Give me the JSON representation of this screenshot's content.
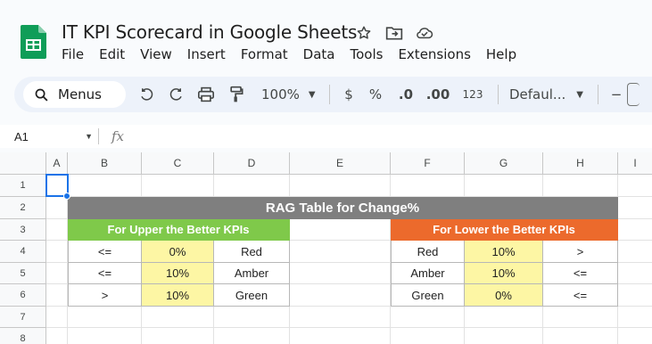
{
  "app": {
    "title": "IT KPI Scorecard in Google Sheets",
    "menu": [
      "File",
      "Edit",
      "View",
      "Insert",
      "Format",
      "Data",
      "Tools",
      "Extensions",
      "Help"
    ]
  },
  "toolbar": {
    "search_label": "Menus",
    "zoom": "100%",
    "currency": "$",
    "percent": "%",
    "decrease_decimal": ".0",
    "increase_decimal": ".00",
    "number_format": "123",
    "font": "Defaul...",
    "minus": "−"
  },
  "formula_bar": {
    "cell_ref": "A1",
    "fx": "fx",
    "value": ""
  },
  "columns": [
    "A",
    "B",
    "C",
    "D",
    "E",
    "F",
    "G",
    "H",
    "I"
  ],
  "rows": [
    "1",
    "2",
    "3",
    "4",
    "5",
    "6",
    "7",
    "8"
  ],
  "sheet": {
    "banner": "RAG Table for Change%",
    "upper": {
      "header": "For Upper the Better KPIs",
      "rows": [
        {
          "op": "<=",
          "value": "0%",
          "status": "Red"
        },
        {
          "op": "<=",
          "value": "10%",
          "status": "Amber"
        },
        {
          "op": ">",
          "value": "10%",
          "status": "Green"
        }
      ]
    },
    "lower": {
      "header": "For Lower the Better KPIs",
      "rows": [
        {
          "status": "Red",
          "value": "10%",
          "op": ">"
        },
        {
          "status": "Amber",
          "value": "10%",
          "op": "<="
        },
        {
          "status": "Green",
          "value": "0%",
          "op": "<="
        }
      ]
    }
  },
  "colors": {
    "banner": "#7f7f7f",
    "upper_header": "#7fc94a",
    "lower_header": "#ec6a2c",
    "value_fill": "#fdf6a4",
    "selection": "#1a73e8"
  }
}
